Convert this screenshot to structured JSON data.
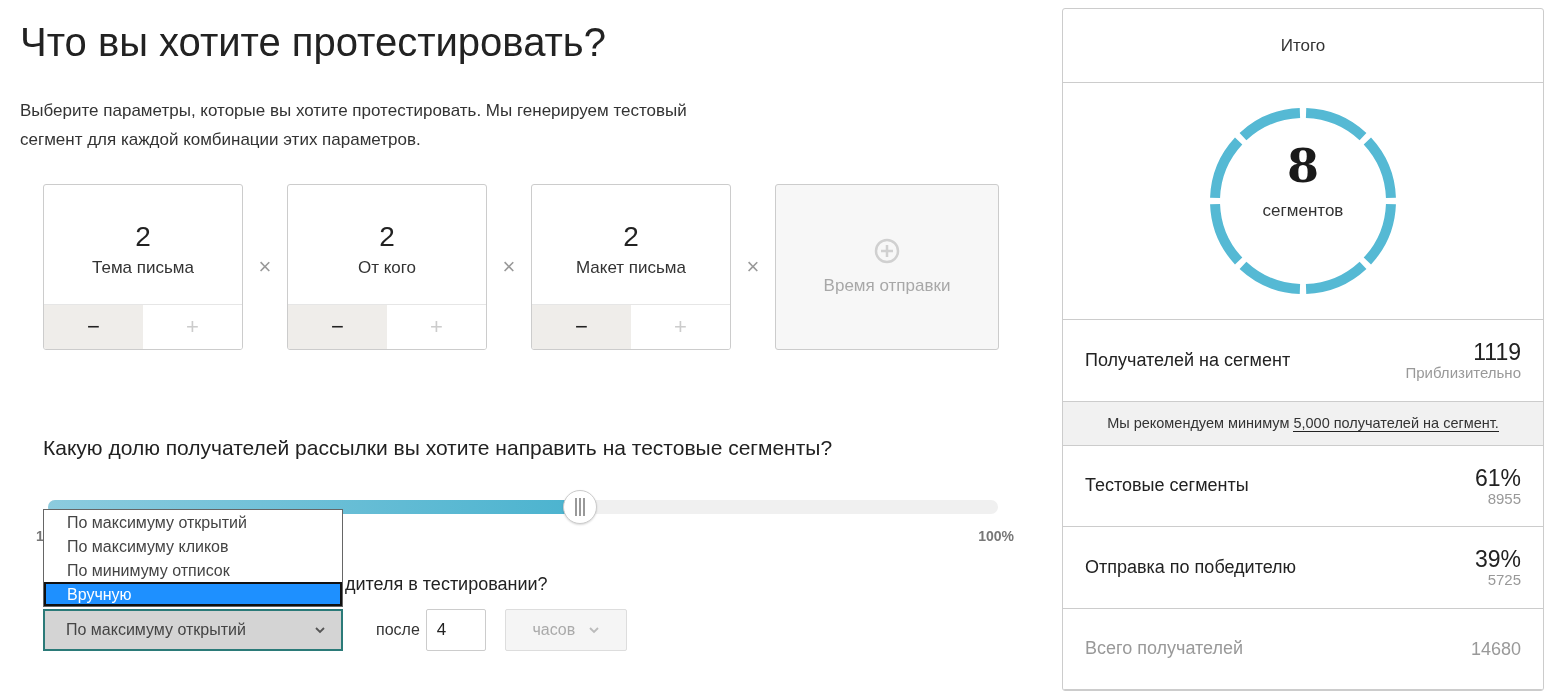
{
  "title": "Что вы хотите протестировать?",
  "description": "Выберите параметры, которые вы хотите протестировать. Мы генерируем тестовый сегмент для каждой комбинации этих параметров.",
  "params": [
    {
      "kind": "counter",
      "count": "2",
      "label": "Тема письма",
      "minus": "−",
      "plus": "+"
    },
    {
      "kind": "counter",
      "count": "2",
      "label": "От кого",
      "minus": "−",
      "plus": "+"
    },
    {
      "kind": "counter",
      "count": "2",
      "label": "Макет письма",
      "minus": "−",
      "plus": "+"
    },
    {
      "kind": "add",
      "label": "Время отправки"
    }
  ],
  "multiply_sign": "×",
  "share_question": "Какую долю получателей рассылки вы хотите направить на тестовые сегменты?",
  "slider": {
    "level": 0.56,
    "min_label": "1",
    "max_label": "100%"
  },
  "winner_question": "дителя в тестировании?",
  "winner_select": {
    "value": "По максимуму открытий",
    "expanded": true,
    "options": [
      {
        "label": "По максимуму открытий",
        "highlighted": false
      },
      {
        "label": "По максимуму кликов",
        "highlighted": false
      },
      {
        "label": "По минимуму отписок",
        "highlighted": false
      },
      {
        "label": "Вручную",
        "highlighted": true
      }
    ]
  },
  "after_label": "после",
  "after_value": "4",
  "unit_select": {
    "value": "часов",
    "disabled": true
  },
  "summary": {
    "title": "Итого",
    "count": "8",
    "count_label": "сегментов",
    "rows": [
      {
        "kind": "main",
        "label": "Получателей на сегмент",
        "value": "1119",
        "sub": "Приблизительно"
      },
      {
        "kind": "note",
        "text": "Мы рекомендуем минимум ",
        "link": "5,000 получателей на сегмент."
      },
      {
        "kind": "main",
        "label": "Тестовые сегменты",
        "value": "61%",
        "sub": "8955"
      },
      {
        "kind": "main",
        "label": "Отправка по победителю",
        "value": "39%",
        "sub": "5725"
      },
      {
        "kind": "muted",
        "label": "Всего получателей",
        "value": "14680"
      }
    ]
  }
}
